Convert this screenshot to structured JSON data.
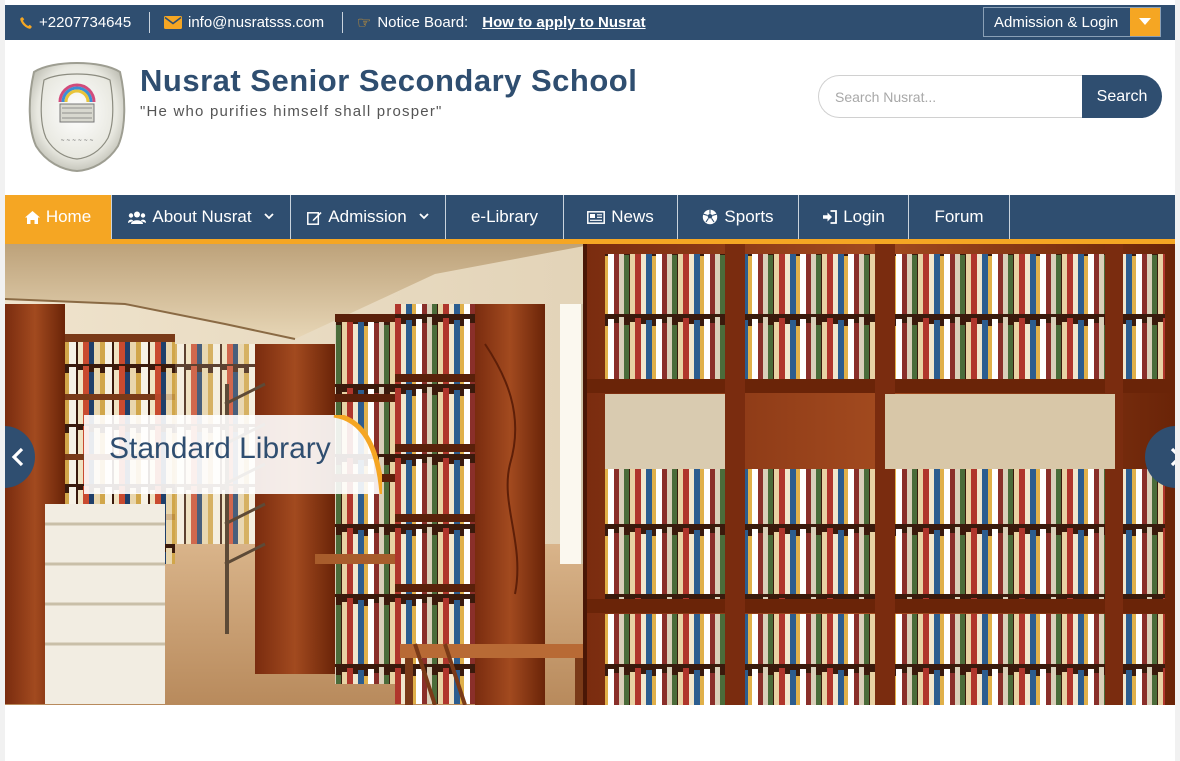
{
  "topbar": {
    "phone": "+2207734645",
    "email": "info@nusratsss.com",
    "notice_label": "Notice Board:",
    "notice_link": "How to apply to Nusrat",
    "admission_button": "Admission & Login",
    "icons": [
      "phone-icon",
      "envelope-icon",
      "hand-point-right-icon",
      "caret-down-icon"
    ]
  },
  "header": {
    "school_name": "Nusrat Senior Secondary School",
    "motto": "\"He who purifies himself shall prosper\"",
    "search_placeholder": "Search Nusrat...",
    "search_button": "Search"
  },
  "nav": {
    "items": [
      {
        "label": "Home",
        "icon": "home-icon",
        "active": true
      },
      {
        "label": "About Nusrat",
        "icon": "users-icon",
        "dropdown": true
      },
      {
        "label": "Admission",
        "icon": "edit-icon",
        "dropdown": true
      },
      {
        "label": "e-Library"
      },
      {
        "label": "News",
        "icon": "newspaper-icon"
      },
      {
        "label": "Sports",
        "icon": "soccer-ball-icon"
      },
      {
        "label": "Login",
        "icon": "sign-in-icon"
      },
      {
        "label": "Forum"
      }
    ]
  },
  "slider": {
    "caption": "Standard Library"
  },
  "colors": {
    "brand_navy": "#2f4e70",
    "accent_orange": "#f5a623"
  }
}
